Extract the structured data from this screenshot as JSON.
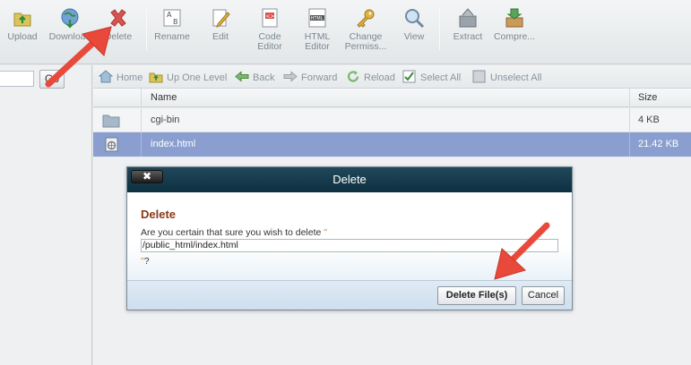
{
  "toolbar": {
    "buttons": [
      {
        "id": "upload",
        "label": "Upload",
        "icon": "upload-icon"
      },
      {
        "id": "download",
        "label": "Download",
        "icon": "download-icon"
      },
      {
        "id": "delete",
        "label": "Delete",
        "icon": "delete-x-icon"
      },
      {
        "id": "rename",
        "label": "Rename",
        "icon": "rename-icon"
      },
      {
        "id": "edit",
        "label": "Edit",
        "icon": "edit-pencil-icon"
      },
      {
        "id": "code-editor",
        "label1": "Code",
        "label2": "Editor",
        "icon": "code-editor-icon"
      },
      {
        "id": "html-editor",
        "label1": "HTML",
        "label2": "Editor",
        "icon": "html-editor-icon"
      },
      {
        "id": "change-permissions",
        "label1": "Change",
        "label2": "Permiss...",
        "icon": "key-icon"
      },
      {
        "id": "view",
        "label": "View",
        "icon": "magnifier-icon"
      },
      {
        "id": "extract",
        "label": "Extract",
        "icon": "extract-icon"
      },
      {
        "id": "compress",
        "label": "Compre...",
        "icon": "compress-icon"
      }
    ]
  },
  "left_pane": {
    "go_label": "Go"
  },
  "nav": {
    "home": "Home",
    "up_one_level": "Up One Level",
    "back": "Back",
    "forward": "Forward",
    "reload": "Reload",
    "select_all": "Select All",
    "unselect_all": "Unselect All"
  },
  "table": {
    "headers": {
      "name": "Name",
      "size": "Size"
    },
    "rows": [
      {
        "name": "cgi-bin",
        "size": "4 KB",
        "type": "folder-icon"
      },
      {
        "name": "index.html",
        "size": "21.42 KB",
        "type": "html-file-icon",
        "selected": true
      }
    ]
  },
  "dialog": {
    "title": "Delete",
    "close_label": "✖",
    "heading": "Delete",
    "question": "Are you certain that sure you wish to delete",
    "required_mark": "\"",
    "path": "/public_html/index.html",
    "q2_mark": "\"",
    "q2_text": "?",
    "delete_button": "Delete File(s)",
    "cancel_button": "Cancel"
  },
  "colors": {
    "dialog_title_bg": "#133a4c",
    "selected_row": "#8a9fd0",
    "dialog_heading": "#8a3a17",
    "annotation_arrow": "#e8493a"
  }
}
